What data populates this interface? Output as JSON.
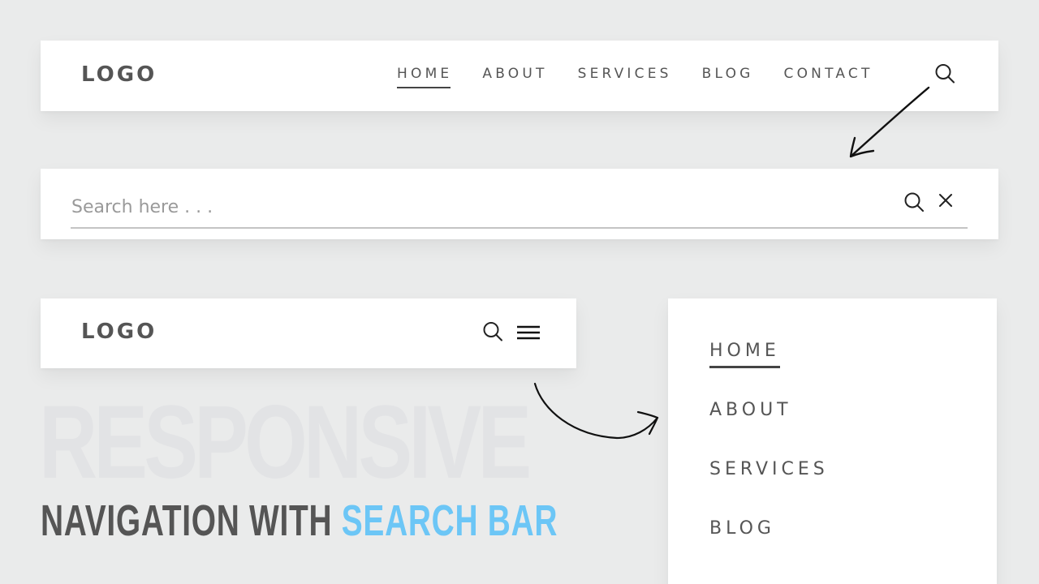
{
  "desktop_nav": {
    "logo": "LOGO",
    "links": [
      {
        "label": "HOME",
        "active": true
      },
      {
        "label": "ABOUT",
        "active": false
      },
      {
        "label": "SERVICES",
        "active": false
      },
      {
        "label": "BLOG",
        "active": false
      },
      {
        "label": "CONTACT",
        "active": false
      }
    ],
    "search_icon": "search-icon"
  },
  "search_bar": {
    "placeholder": "Search here . . .",
    "value": "",
    "search_icon": "search-icon",
    "close_icon": "close-icon"
  },
  "mobile_nav": {
    "logo": "LOGO",
    "search_icon": "search-icon",
    "menu_icon": "hamburger-menu-icon"
  },
  "mobile_menu": {
    "links": [
      {
        "label": "HOME",
        "active": true
      },
      {
        "label": "ABOUT",
        "active": false
      },
      {
        "label": "SERVICES",
        "active": false
      },
      {
        "label": "BLOG",
        "active": false
      }
    ]
  },
  "title": {
    "background_word": "RESPONSIVE",
    "line_dark": "NAVIGATION WITH ",
    "line_accent": "SEARCH BAR"
  },
  "colors": {
    "background": "#eaebeb",
    "text": "#555555",
    "accent": "#6cc6f6"
  }
}
